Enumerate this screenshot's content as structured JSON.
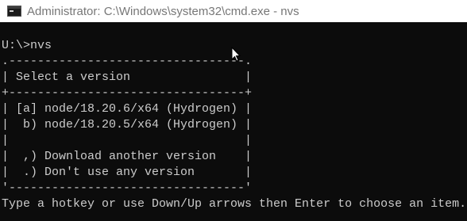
{
  "window": {
    "title": "Administrator: C:\\Windows\\system32\\cmd.exe - nvs",
    "icon": "cmd-console-icon"
  },
  "console": {
    "lines": [
      "U:\\>nvs",
      ".---------------------------------.",
      "| Select a version                |",
      "+---------------------------------+",
      "| [a] node/18.20.6/x64 (Hydrogen) |",
      "|  b) node/18.20.5/x64 (Hydrogen) |",
      "|                                 |",
      "|  ,) Download another version    |",
      "|  .) Don't use any version       |",
      "'---------------------------------'",
      "Type a hotkey or use Down/Up arrows then Enter to choose an item."
    ],
    "text_color": "#cccccc",
    "background_color": "#0c0c0c"
  },
  "pointer": {
    "icon": "mouse-pointer-icon"
  }
}
